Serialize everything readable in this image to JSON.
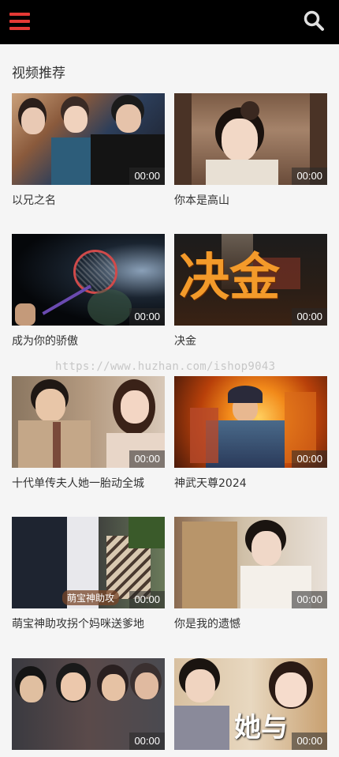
{
  "header": {
    "menu_icon": "hamburger-menu-icon",
    "search_icon": "search-icon",
    "background": "#000000",
    "accent": "#e53935"
  },
  "section": {
    "title": "视频推荐"
  },
  "videos": [
    {
      "title": "以兄之名",
      "duration": "00:00"
    },
    {
      "title": "你本是高山",
      "duration": "00:00"
    },
    {
      "title": "成为你的骄傲",
      "duration": "00:00"
    },
    {
      "title": "决金",
      "duration": "00:00",
      "poster_text": "决金"
    },
    {
      "title": "十代单传夫人她一胎动全城",
      "duration": "00:00"
    },
    {
      "title": "神武天尊2024",
      "duration": "00:00"
    },
    {
      "title": "萌宝神助攻拐个妈咪送爹地",
      "duration": "00:00",
      "poster_text": "萌宝神助攻"
    },
    {
      "title": "你是我的遗憾",
      "duration": "00:00"
    },
    {
      "title": "",
      "duration": "00:00"
    },
    {
      "title": "",
      "duration": "00:00",
      "poster_text": "她与"
    }
  ],
  "watermark": "https://www.huzhan.com/ishop9043"
}
